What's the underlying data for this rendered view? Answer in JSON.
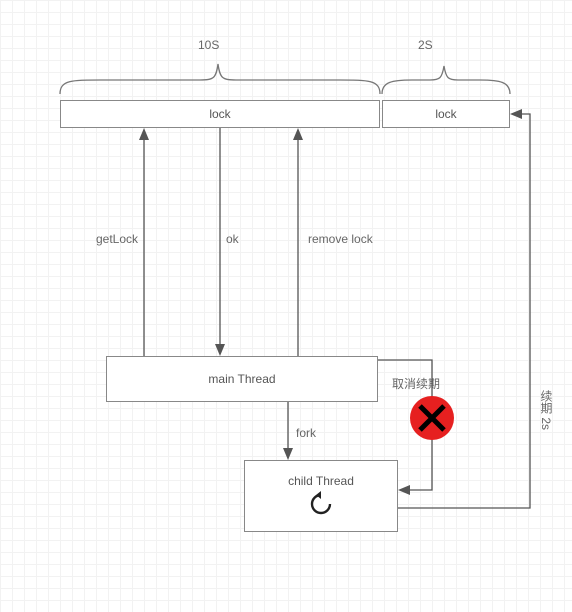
{
  "top_labels": {
    "left": "10S",
    "right": "2S"
  },
  "boxes": {
    "lock_left": "lock",
    "lock_right": "lock",
    "main_thread": "main Thread",
    "child_thread": "child Thread"
  },
  "edge_labels": {
    "get_lock": "getLock",
    "ok": "ok",
    "remove_lock": "remove lock",
    "fork": "fork",
    "cancel_renew": "取消续期",
    "renew_2s": "续期 2s"
  },
  "icons": {
    "cancel": "cancel-icon",
    "refresh": "refresh-icon"
  }
}
